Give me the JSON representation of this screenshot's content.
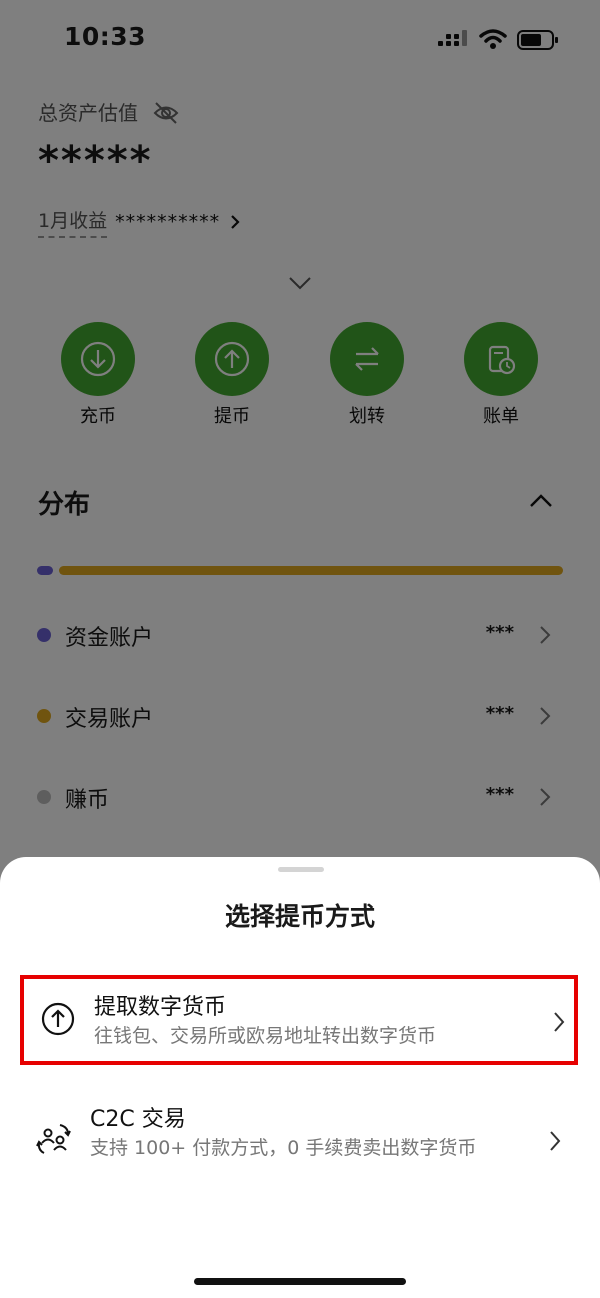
{
  "status_bar": {
    "time": "10:33"
  },
  "assets": {
    "total_label": "总资产估值",
    "total_value": "*****",
    "monthly_label": "1月收益",
    "monthly_value": "**********"
  },
  "actions": [
    {
      "label": "充币",
      "icon": "deposit-icon"
    },
    {
      "label": "提币",
      "icon": "withdraw-icon"
    },
    {
      "label": "划转",
      "icon": "transfer-icon"
    },
    {
      "label": "账单",
      "icon": "bill-icon"
    }
  ],
  "distribution": {
    "title": "分布",
    "accounts": [
      {
        "name": "资金账户",
        "value": "***",
        "color": "#6b61d4"
      },
      {
        "name": "交易账户",
        "value": "***",
        "color": "#e0a91e"
      },
      {
        "name": "赚币",
        "value": "***",
        "color": "#bdbdbd"
      }
    ]
  },
  "sheet": {
    "title": "选择提币方式",
    "options": [
      {
        "title": "提取数字货币",
        "desc": "往钱包、交易所或欧易地址转出数字货币",
        "icon": "upload-circle-icon"
      },
      {
        "title": "C2C 交易",
        "desc": "支持 100+ 付款方式，0 手续费卖出数字货币",
        "icon": "c2c-exchange-icon"
      }
    ]
  },
  "colors": {
    "accent_green": "#43a830",
    "highlight_red": "#e60000"
  }
}
